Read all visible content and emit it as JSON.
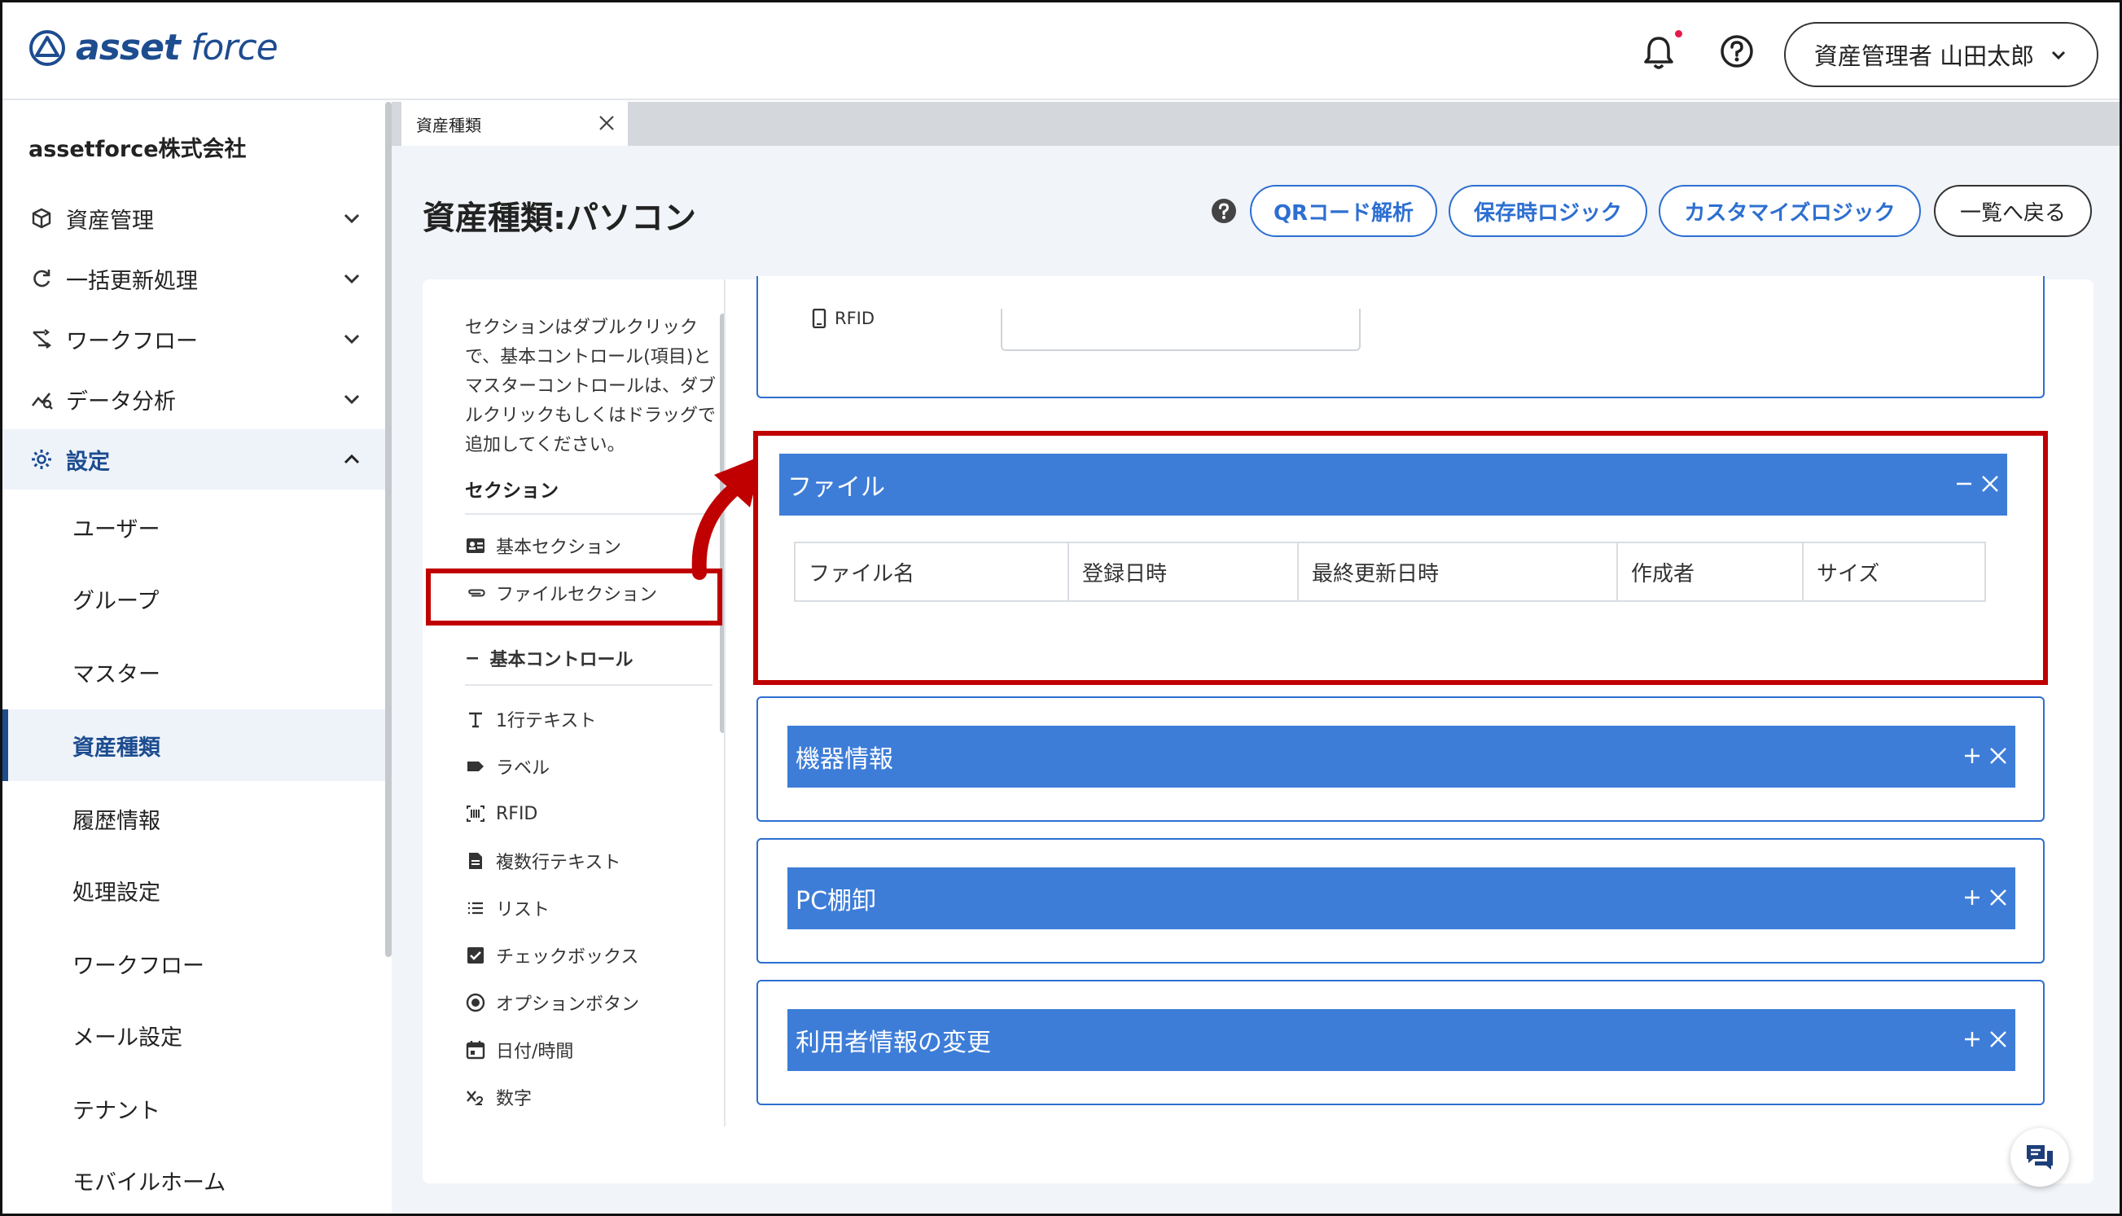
{
  "app": {
    "logo_text_bold": "asset",
    "logo_text": " force"
  },
  "header": {
    "user_name": "資産管理者 山田太郎"
  },
  "sidebar": {
    "company": "assetforce株式会社",
    "nav": [
      {
        "label": "資産管理",
        "icon": "cube-icon"
      },
      {
        "label": "一括更新処理",
        "icon": "refresh-icon"
      },
      {
        "label": "ワークフロー",
        "icon": "workflow-icon"
      },
      {
        "label": "データ分析",
        "icon": "analytics-icon"
      },
      {
        "label": "設定",
        "icon": "gear-icon",
        "expanded": true
      }
    ],
    "sub_items": [
      "ユーザー",
      "グループ",
      "マスター",
      "資産種類",
      "履歴情報",
      "処理設定",
      "ワークフロー",
      "メール設定",
      "テナント",
      "モバイルホーム"
    ],
    "active_sub": "資産種類"
  },
  "tab": {
    "label": "資産種類"
  },
  "page": {
    "title": "資産種類:パソコン",
    "buttons": {
      "qr": "QRコード解析",
      "save_logic": "保存時ロジック",
      "custom_logic": "カスタマイズロジック",
      "back": "一覧へ戻る"
    }
  },
  "palette": {
    "hint": "セクションはダブルクリックで、基本コントロール(項目)とマスターコントロールは、ダブルクリックもしくはドラッグで追加してください。",
    "section_heading": "セクション",
    "sections": [
      "基本セクション",
      "ファイルセクション"
    ],
    "controls_heading": "基本コントロール",
    "controls_collapse": "−",
    "controls": [
      {
        "label": "1行テキスト",
        "icon": "text-icon"
      },
      {
        "label": "ラベル",
        "icon": "tag-icon"
      },
      {
        "label": "RFID",
        "icon": "rfid-icon"
      },
      {
        "label": "複数行テキスト",
        "icon": "document-icon"
      },
      {
        "label": "リスト",
        "icon": "list-icon"
      },
      {
        "label": "チェックボックス",
        "icon": "checkbox-icon"
      },
      {
        "label": "オプションボタン",
        "icon": "radio-icon"
      },
      {
        "label": "日付/時間",
        "icon": "calendar-icon"
      },
      {
        "label": "数字",
        "icon": "number-icon"
      }
    ]
  },
  "canvas": {
    "rfid_field_label": "RFID",
    "file_section": {
      "title": "ファイル",
      "columns": [
        "ファイル名",
        "登録日時",
        "最終更新日時",
        "作成者",
        "サイズ"
      ]
    },
    "sections": [
      "機器情報",
      "PC棚卸",
      "利用者情報の変更"
    ]
  },
  "colors": {
    "brand": "#1d4c8f",
    "accent": "#2d6fd1",
    "section_bar": "#3d7dd8",
    "highlight": "#c00000"
  }
}
